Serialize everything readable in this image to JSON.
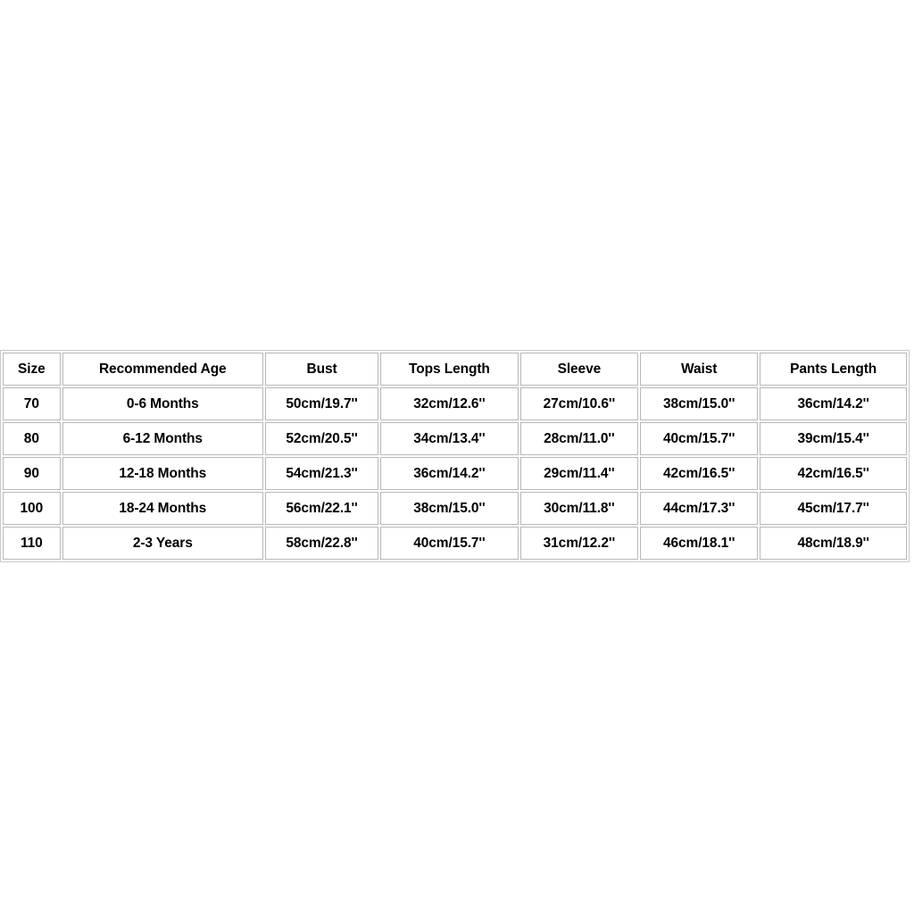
{
  "page": {
    "background_color": "#ffffff",
    "text_color": "#000000",
    "border_color": "#b8b8b8"
  },
  "size_chart": {
    "name": "size-chart",
    "columns": [
      "Size",
      "Recommended Age",
      "Bust",
      "Tops Length",
      "Sleeve",
      "Waist",
      "Pants Length"
    ],
    "rows": [
      {
        "size": "70",
        "age": "0-6 Months",
        "bust": "50cm/19.7''",
        "tops_length": "32cm/12.6''",
        "sleeve": "27cm/10.6''",
        "waist": "38cm/15.0''",
        "pants_length": "36cm/14.2''"
      },
      {
        "size": "80",
        "age": "6-12 Months",
        "bust": "52cm/20.5''",
        "tops_length": "34cm/13.4''",
        "sleeve": "28cm/11.0''",
        "waist": "40cm/15.7''",
        "pants_length": "39cm/15.4''"
      },
      {
        "size": "90",
        "age": "12-18 Months",
        "bust": "54cm/21.3''",
        "tops_length": "36cm/14.2''",
        "sleeve": "29cm/11.4''",
        "waist": "42cm/16.5''",
        "pants_length": "42cm/16.5''"
      },
      {
        "size": "100",
        "age": "18-24 Months",
        "bust": "56cm/22.1''",
        "tops_length": "38cm/15.0''",
        "sleeve": "30cm/11.8''",
        "waist": "44cm/17.3''",
        "pants_length": "45cm/17.7''"
      },
      {
        "size": "110",
        "age": "2-3 Years",
        "bust": "58cm/22.8''",
        "tops_length": "40cm/15.7''",
        "sleeve": "31cm/12.2''",
        "waist": "46cm/18.1''",
        "pants_length": "48cm/18.9''"
      }
    ]
  }
}
